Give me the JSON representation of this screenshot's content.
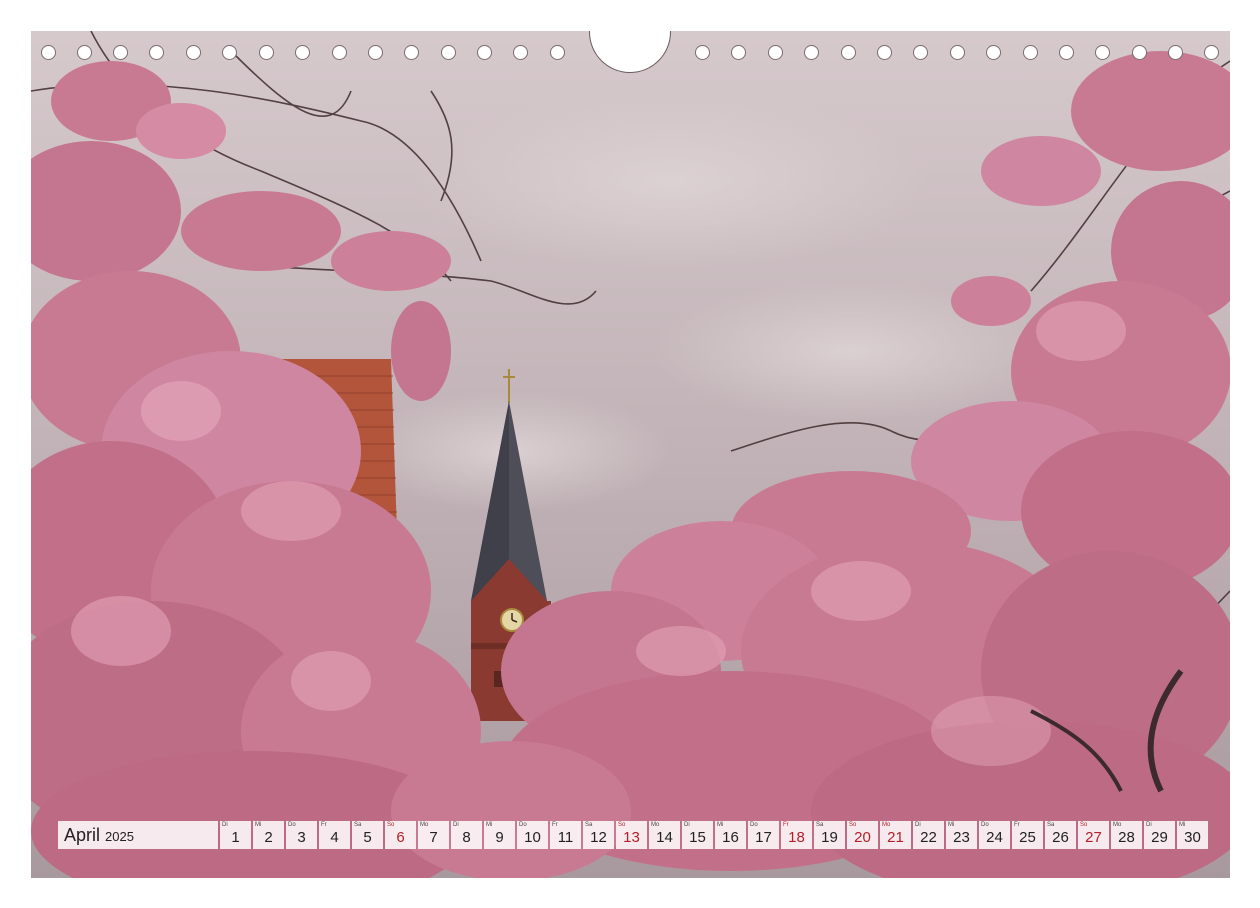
{
  "calendar": {
    "month": "April",
    "year": "2025",
    "days": [
      {
        "wd": "Di",
        "n": "1",
        "red": false
      },
      {
        "wd": "Mi",
        "n": "2",
        "red": false
      },
      {
        "wd": "Do",
        "n": "3",
        "red": false
      },
      {
        "wd": "Fr",
        "n": "4",
        "red": false
      },
      {
        "wd": "Sa",
        "n": "5",
        "red": false
      },
      {
        "wd": "So",
        "n": "6",
        "red": true
      },
      {
        "wd": "Mo",
        "n": "7",
        "red": false
      },
      {
        "wd": "Di",
        "n": "8",
        "red": false
      },
      {
        "wd": "Mi",
        "n": "9",
        "red": false
      },
      {
        "wd": "Do",
        "n": "10",
        "red": false
      },
      {
        "wd": "Fr",
        "n": "11",
        "red": false
      },
      {
        "wd": "Sa",
        "n": "12",
        "red": false
      },
      {
        "wd": "So",
        "n": "13",
        "red": true
      },
      {
        "wd": "Mo",
        "n": "14",
        "red": false
      },
      {
        "wd": "Di",
        "n": "15",
        "red": false
      },
      {
        "wd": "Mi",
        "n": "16",
        "red": false
      },
      {
        "wd": "Do",
        "n": "17",
        "red": false
      },
      {
        "wd": "Fr",
        "n": "18",
        "red": true
      },
      {
        "wd": "Sa",
        "n": "19",
        "red": false
      },
      {
        "wd": "So",
        "n": "20",
        "red": true
      },
      {
        "wd": "Mo",
        "n": "21",
        "red": true
      },
      {
        "wd": "Di",
        "n": "22",
        "red": false
      },
      {
        "wd": "Mi",
        "n": "23",
        "red": false
      },
      {
        "wd": "Do",
        "n": "24",
        "red": false
      },
      {
        "wd": "Fr",
        "n": "25",
        "red": false
      },
      {
        "wd": "Sa",
        "n": "26",
        "red": false
      },
      {
        "wd": "So",
        "n": "27",
        "red": true
      },
      {
        "wd": "Mo",
        "n": "28",
        "red": false
      },
      {
        "wd": "Di",
        "n": "29",
        "red": false
      },
      {
        "wd": "Mi",
        "n": "30",
        "red": false
      }
    ]
  },
  "colors": {
    "sky": "#c4b6ba",
    "blossom": "#c97a93",
    "blossom_light": "#e2a4b8",
    "roof": "#b4553a",
    "spire": "#4e4f58",
    "tower_brick": "#8a3a30",
    "holiday_red": "#b3202a"
  },
  "photo": {
    "icons": [
      "cherry-blossom-tree",
      "church-tower",
      "clock",
      "tiled-roof"
    ]
  }
}
